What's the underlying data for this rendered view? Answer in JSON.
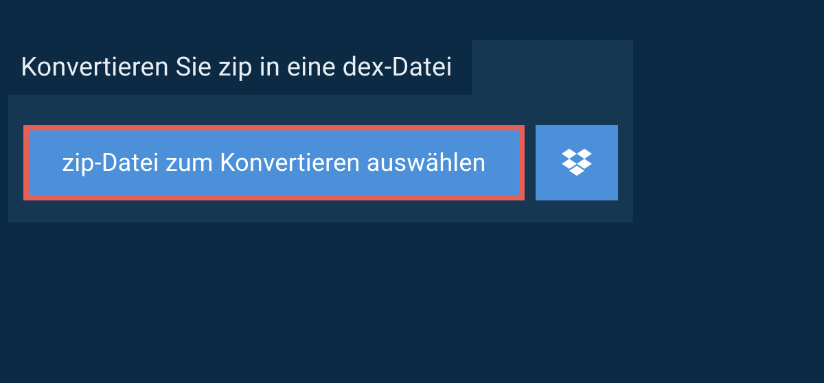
{
  "header": {
    "title": "Konvertieren Sie zip in eine dex-Datei"
  },
  "actions": {
    "select_file_label": "zip-Datei zum Konvertieren auswählen"
  },
  "colors": {
    "page_bg": "#0c2a43",
    "panel_bg": "#163752",
    "button_bg": "#4b90d8",
    "highlight_border": "#e85f56",
    "text_light": "#ffffff"
  }
}
